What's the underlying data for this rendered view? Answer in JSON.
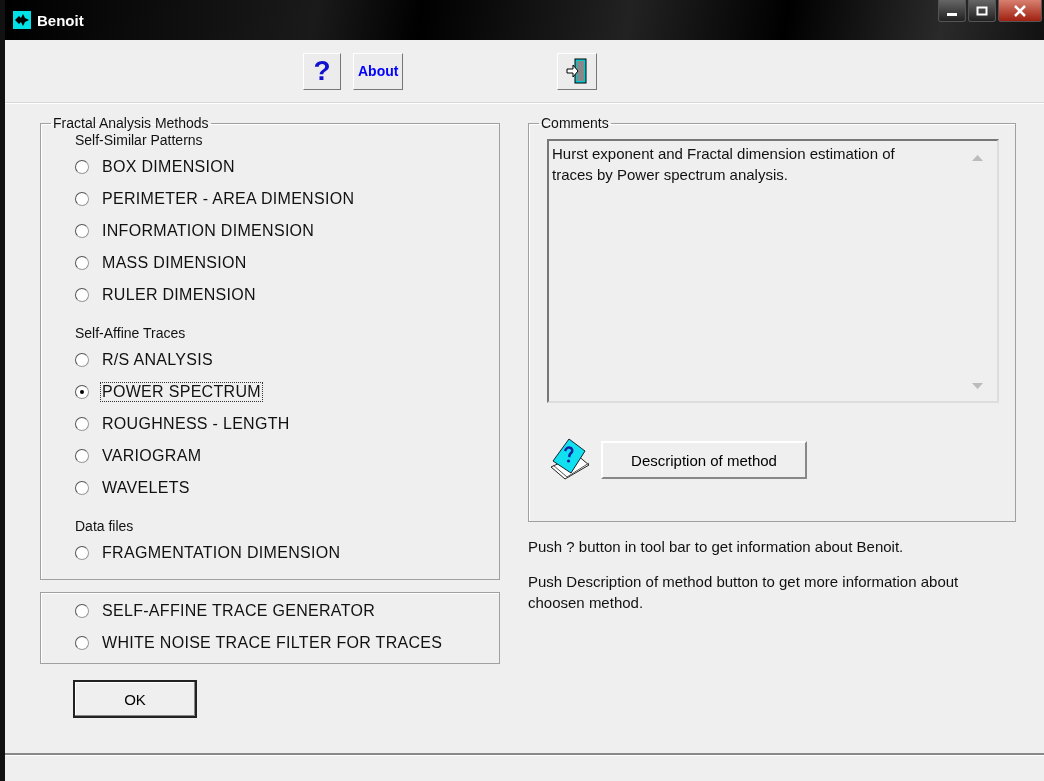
{
  "window": {
    "title": "Benoit"
  },
  "toolbar": [
    {
      "kind": "help",
      "label": "?"
    },
    {
      "kind": "about",
      "label": "About"
    },
    {
      "kind": "exit"
    }
  ],
  "methods": {
    "title": "Fractal Analysis Methods",
    "sections": [
      {
        "heading": "Self-Similar Patterns",
        "options": [
          {
            "label": "BOX DIMENSION",
            "selected": false
          },
          {
            "label": "PERIMETER - AREA DIMENSION",
            "selected": false
          },
          {
            "label": "INFORMATION DIMENSION",
            "selected": false
          },
          {
            "label": "MASS DIMENSION",
            "selected": false
          },
          {
            "label": "RULER DIMENSION",
            "selected": false
          }
        ]
      },
      {
        "heading": "Self-Affine Traces",
        "options": [
          {
            "label": "R/S ANALYSIS",
            "selected": false
          },
          {
            "label": "POWER SPECTRUM",
            "selected": true
          },
          {
            "label": "ROUGHNESS - LENGTH",
            "selected": false
          },
          {
            "label": "VARIOGRAM",
            "selected": false
          },
          {
            "label": "WAVELETS",
            "selected": false
          }
        ]
      },
      {
        "heading": "Data files",
        "options": [
          {
            "label": "FRAGMENTATION DIMENSION",
            "selected": false
          }
        ]
      }
    ]
  },
  "tools": [
    {
      "label": "SELF-AFFINE TRACE GENERATOR",
      "selected": false
    },
    {
      "label": "WHITE NOISE TRACE FILTER FOR TRACES",
      "selected": false
    }
  ],
  "ok_button": "OK",
  "comments": {
    "title": "Comments",
    "text": "Hurst exponent and Fractal dimension estimation of traces  by Power spectrum analysis.",
    "description_button": "Description of method"
  },
  "hints": [
    "Push ? button in tool bar to get information about Benoit.",
    "Push Description of method button to get more information about choosen method."
  ]
}
